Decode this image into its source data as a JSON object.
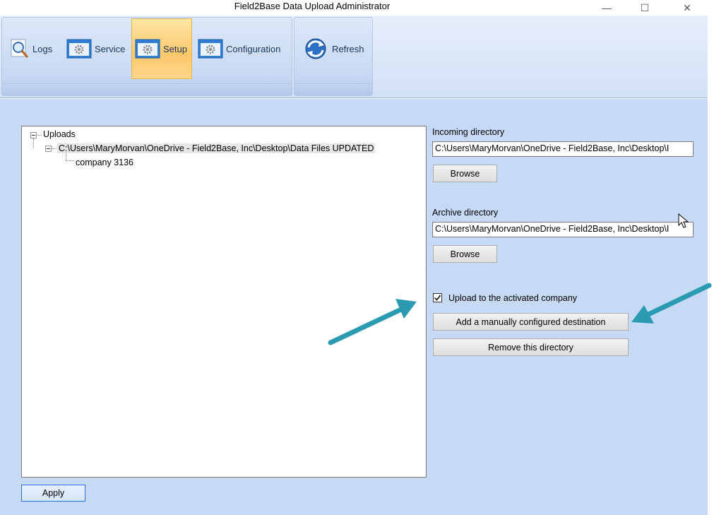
{
  "window": {
    "title": "Field2Base Data Upload Administrator",
    "minimize_glyph": "—",
    "maximize_glyph": "☐",
    "close_glyph": "✕"
  },
  "ribbon": {
    "buttons": [
      {
        "label": "Logs",
        "icon": "magnifier-icon"
      },
      {
        "label": "Service",
        "icon": "gear-icon"
      },
      {
        "label": "Setup",
        "icon": "gear-icon",
        "active": true
      },
      {
        "label": "Configuration",
        "icon": "gear-icon"
      },
      {
        "label": "Refresh",
        "icon": "refresh-icon"
      }
    ]
  },
  "tree": {
    "root": "Uploads",
    "child": "C:\\Users\\MaryMorvan\\OneDrive - Field2Base, Inc\\Desktop\\Data Files UPDATED",
    "grandchild": "company 3136"
  },
  "incoming": {
    "label": "Incoming directory",
    "value": "C:\\Users\\MaryMorvan\\OneDrive - Field2Base, Inc\\Desktop\\I",
    "browse_label": "Browse"
  },
  "archive": {
    "label": "Archive directory",
    "value": "C:\\Users\\MaryMorvan\\OneDrive - Field2Base, Inc\\Desktop\\I",
    "browse_label": "Browse"
  },
  "upload_checkbox": {
    "label": "Upload to the activated company",
    "checked": true
  },
  "add_destination_label": "Add a manually configured destination",
  "remove_directory_label": "Remove this directory",
  "apply_label": "Apply",
  "colors": {
    "background": "#c7daf5",
    "active_tab": "#fcc76a",
    "annotation_arrow": "#2a9bb0"
  }
}
